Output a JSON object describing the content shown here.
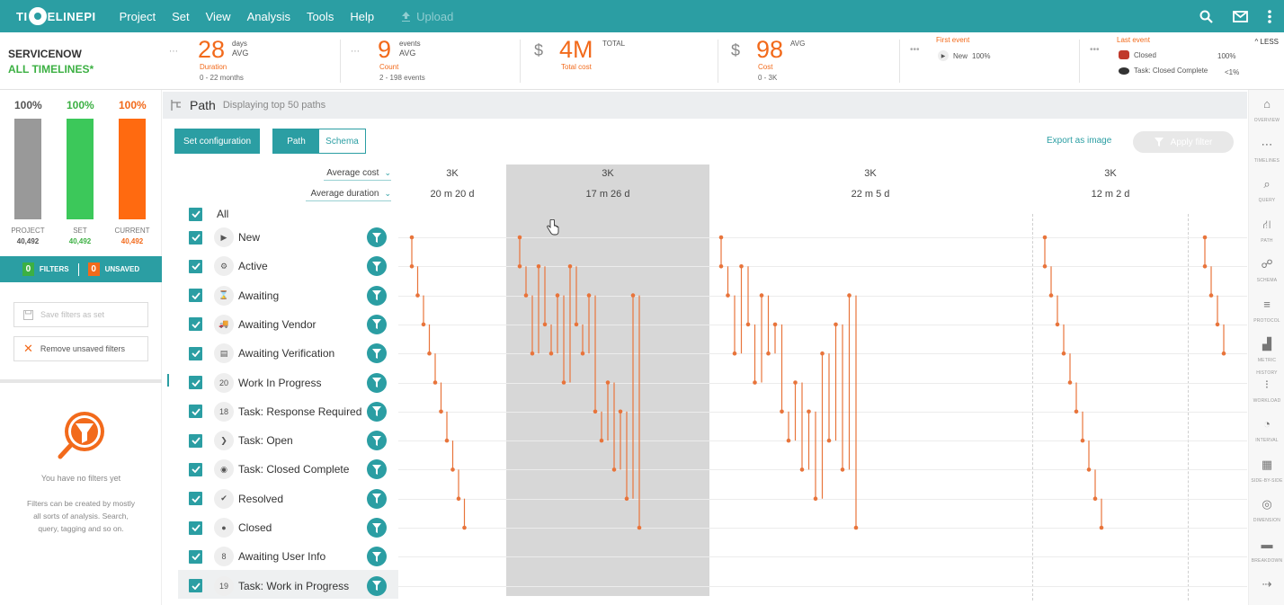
{
  "app": {
    "logo_left": "TI",
    "logo_right": "ELINEPI",
    "menu": [
      "Project",
      "Set",
      "View",
      "Analysis",
      "Tools",
      "Help"
    ],
    "upload_label": "Upload"
  },
  "header": {
    "service_name": "SERVICENOW",
    "timeline_name": "ALL TIMELINES*",
    "duration": {
      "value": "28",
      "unit1": "days",
      "unit2": "AVG",
      "label": "Duration",
      "sub": "0 - 22 months"
    },
    "count": {
      "value": "9",
      "unit1": "events",
      "unit2": "AVG",
      "label": "Count",
      "sub": "2 - 198 events"
    },
    "total_cost": {
      "symbol": "$",
      "value": "4M",
      "unit": "TOTAL",
      "label": "Total cost"
    },
    "avg_cost": {
      "symbol": "$",
      "value": "98",
      "unit": "AVG",
      "label": "Cost",
      "sub": "0 - 3K"
    },
    "first_event": {
      "title": "First event",
      "name": "New",
      "pct": "100%"
    },
    "last_event": {
      "title": "Last event",
      "rows": [
        {
          "name": "Closed",
          "pct": "100%"
        },
        {
          "name": "Task: Closed Complete",
          "pct": "<1%"
        }
      ]
    },
    "less_label": "LESS"
  },
  "left": {
    "bars": [
      {
        "pct": "100%",
        "caption": "PROJECT",
        "value": "40,492",
        "color": "#999999",
        "pct_color": "#555555",
        "val_color": "#555555"
      },
      {
        "pct": "100%",
        "caption": "SET",
        "value": "40,492",
        "color": "#3cc85a",
        "pct_color": "#3cb043",
        "val_color": "#3cb043"
      },
      {
        "pct": "100%",
        "caption": "CURRENT",
        "value": "40,492",
        "color": "#ff6a10",
        "pct_color": "#f26a1b",
        "val_color": "#f26a1b"
      }
    ],
    "filters_count": "0",
    "filters_label": "FILTERS",
    "unsaved_count": "0",
    "unsaved_label": "UNSAVED",
    "save_filters": "Save filters as set",
    "remove_filters": "Remove unsaved filters",
    "no_filters_title": "You have no filters yet",
    "no_filters_text": "Filters can be created by mostly all sorts of analysis. Search, query, tagging and so on."
  },
  "path": {
    "title": "Path",
    "subtitle": "Displaying top 50 paths",
    "set_config": "Set configuration",
    "toggle_path": "Path",
    "toggle_schema": "Schema",
    "export": "Export as image",
    "apply_filter": "Apply filter",
    "avg_cost_dd": "Average cost",
    "avg_duration_dd": "Average duration",
    "columns": [
      {
        "cost": "3K",
        "duration": "20 m 20 d"
      },
      {
        "cost": "3K",
        "duration": "17 m 26 d"
      },
      {
        "cost": "3K",
        "duration": "22 m 5 d"
      },
      {
        "cost": "3K",
        "duration": "12 m 2 d"
      }
    ],
    "all_label": "All",
    "events": [
      {
        "label": "New",
        "icon": "▶",
        "num": ""
      },
      {
        "label": "Active",
        "icon": "⚙",
        "num": ""
      },
      {
        "label": "Awaiting",
        "icon": "⌛",
        "num": ""
      },
      {
        "label": "Awaiting Vendor",
        "icon": "🚚",
        "num": ""
      },
      {
        "label": "Awaiting Verification",
        "icon": "▤",
        "num": ""
      },
      {
        "label": "Work In Progress",
        "icon": "",
        "num": "20"
      },
      {
        "label": "Task: Response Required",
        "icon": "",
        "num": "18"
      },
      {
        "label": "Task: Open",
        "icon": "❯",
        "num": ""
      },
      {
        "label": "Task: Closed Complete",
        "icon": "◉",
        "num": ""
      },
      {
        "label": "Resolved",
        "icon": "✔",
        "num": ""
      },
      {
        "label": "Closed",
        "icon": "●",
        "num": ""
      },
      {
        "label": "Awaiting User Info",
        "icon": "",
        "num": "8"
      },
      {
        "label": "Task: Work in Progress",
        "icon": "",
        "num": "19"
      }
    ]
  },
  "rightbar": [
    {
      "name": "overview",
      "icon": "⌂",
      "caption": "OVERVIEW"
    },
    {
      "name": "timelines",
      "icon": "⋯",
      "caption": "TIMELINES"
    },
    {
      "name": "query",
      "icon": "⌕",
      "caption": "QUERY"
    },
    {
      "name": "path",
      "icon": "⛙",
      "caption": "PATH"
    },
    {
      "name": "schema",
      "icon": "☍",
      "caption": "SCHEMA"
    },
    {
      "name": "protocol",
      "icon": "≡",
      "caption": "PROTOCOL"
    },
    {
      "name": "metric-history",
      "icon": "▟",
      "caption": "METRIC HISTORY"
    },
    {
      "name": "workload",
      "icon": "⁝",
      "caption": "WORKLOAD"
    },
    {
      "name": "interval",
      "icon": "◔",
      "caption": "INTERVAL"
    },
    {
      "name": "side-by-side",
      "icon": "▦",
      "caption": "SIDE-BY-SIDE"
    },
    {
      "name": "dimension",
      "icon": "◎",
      "caption": "DIMENSION"
    },
    {
      "name": "breakdown",
      "icon": "▬",
      "caption": "BREAKDOWN"
    },
    {
      "name": "more",
      "icon": "⇢",
      "caption": ""
    }
  ],
  "colors": {
    "teal": "#2b9ea3",
    "orange": "#f26a1b",
    "green": "#3cb043",
    "path_line": "#e8743b"
  }
}
